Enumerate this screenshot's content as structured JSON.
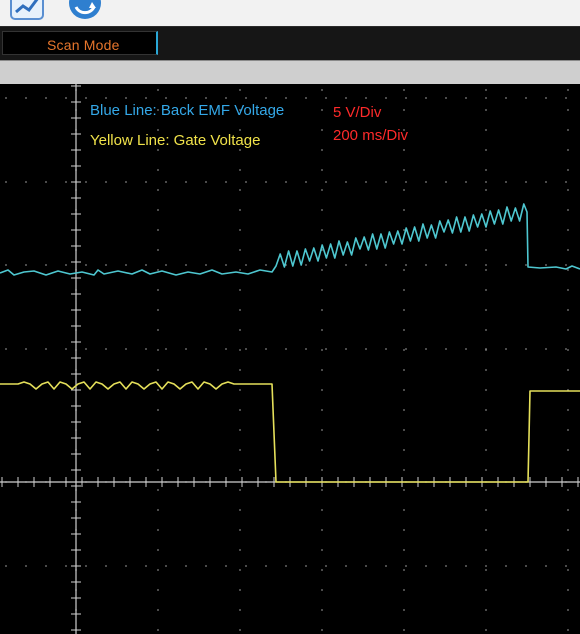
{
  "toolbar": {
    "icons": [
      "line-chart-icon",
      "refresh-icon"
    ]
  },
  "mode_bar": {
    "mode_label": "Scan Mode"
  },
  "scope": {
    "legend": {
      "blue": "Blue Line: Back EMF Voltage",
      "yellow": "Yellow Line: Gate Voltage"
    },
    "settings": {
      "volts_per_div": "5 V/Div",
      "time_per_div": "200 ms/Div"
    }
  },
  "colors": {
    "blue_trace": "#4ec7d0",
    "yellow_trace": "#e5e05a",
    "label_blue": "#34a8e8",
    "label_yellow": "#f0e24a",
    "label_red": "#ff2a2a",
    "mode_text": "#e7762c"
  }
}
